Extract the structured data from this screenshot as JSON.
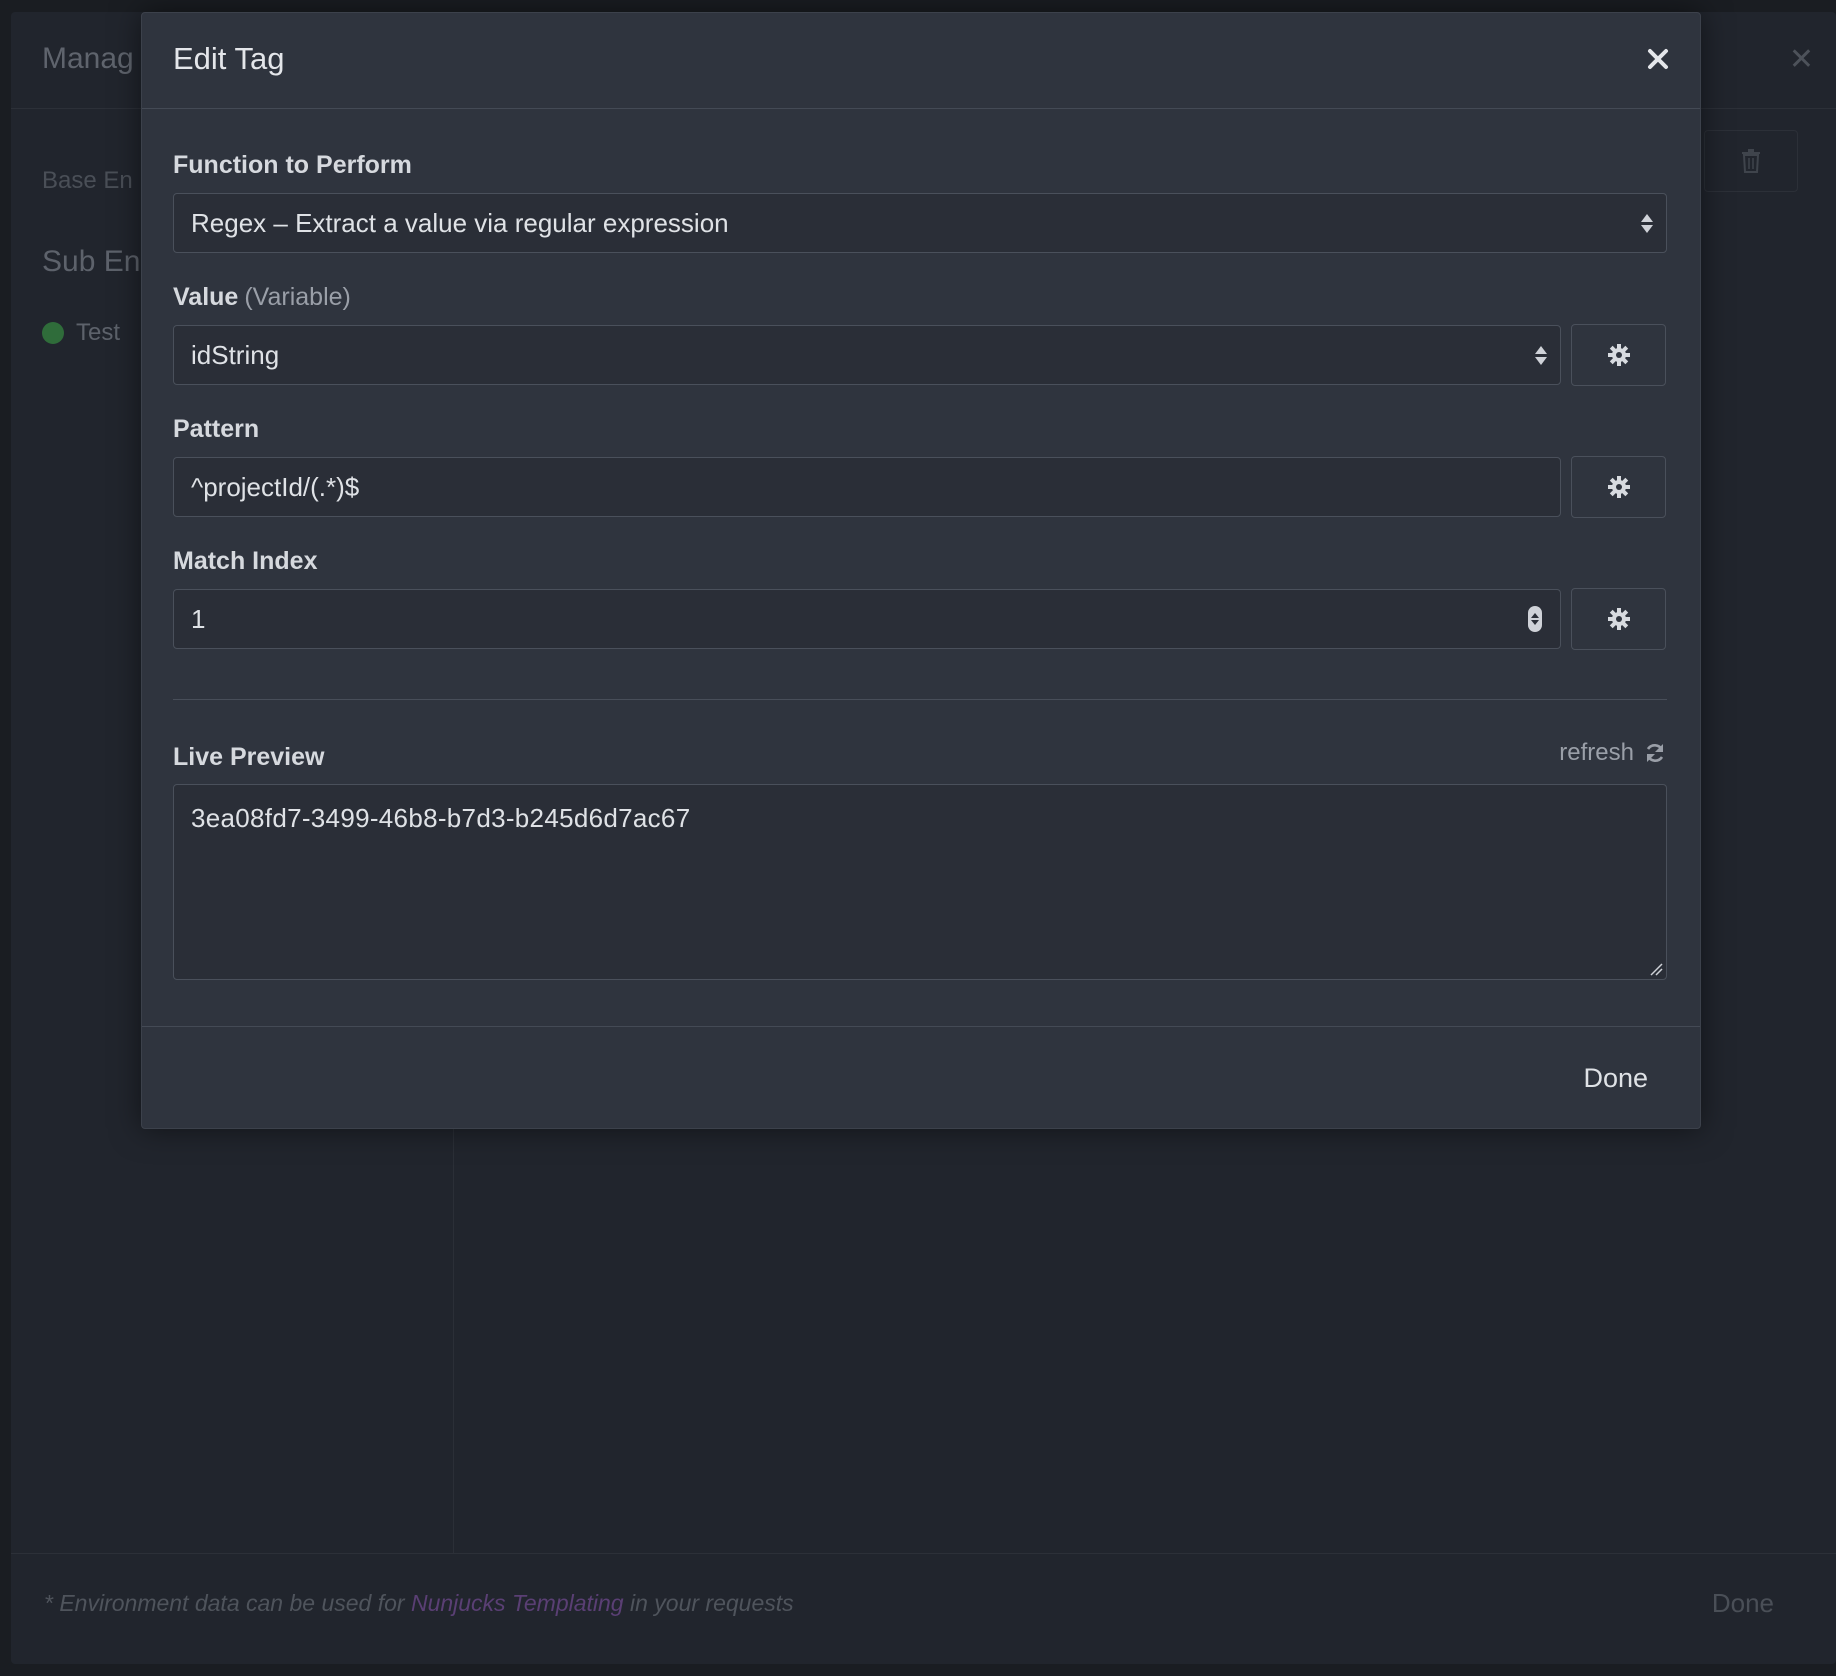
{
  "background": {
    "title": "Manag",
    "base_label": "Base En",
    "sub_label": "Sub En",
    "env_item": "Test",
    "env_item_color": "#2f6c3a",
    "footer_note_prefix": "* Environment data can be used for ",
    "footer_note_link": "Nunjucks Templating",
    "footer_note_suffix": " in your requests",
    "done_label": "Done"
  },
  "dialog": {
    "title": "Edit Tag",
    "function_label": "Function to Perform",
    "function_value": "Regex – Extract a value via regular expression",
    "value_label": "Value",
    "value_hint": "(Variable)",
    "value_value": "idString",
    "pattern_label": "Pattern",
    "pattern_value": "^projectId/(.*)$",
    "match_index_label": "Match Index",
    "match_index_value": "1",
    "live_preview_label": "Live Preview",
    "refresh_label": "refresh",
    "preview_value": "3ea08fd7-3499-46b8-b7d3-b245d6d7ac67",
    "done_label": "Done"
  },
  "icons": [
    "close-icon",
    "gear-icon",
    "refresh-icon",
    "trash-icon",
    "select-arrows-icon",
    "number-spinner-icon"
  ]
}
